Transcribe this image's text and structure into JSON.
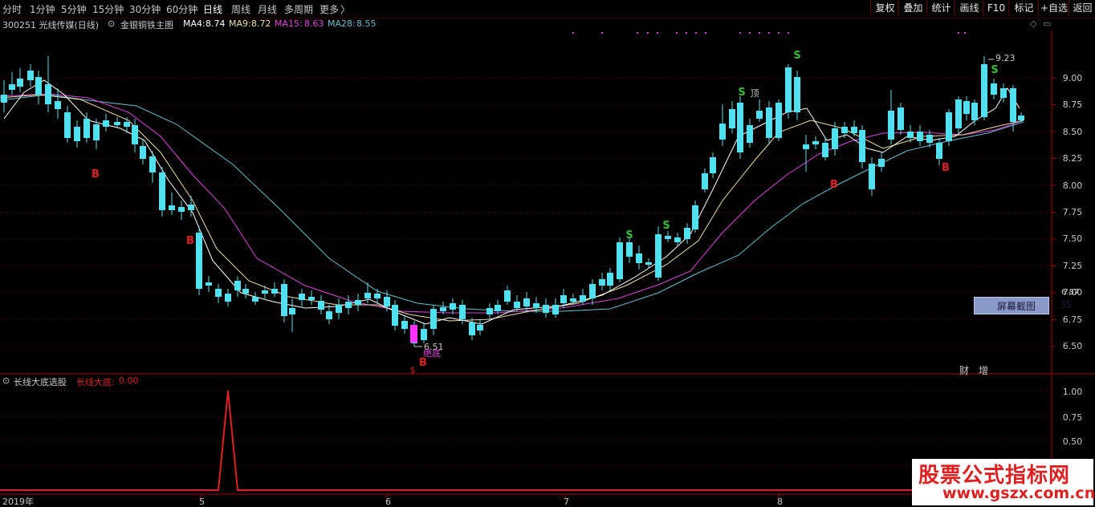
{
  "topbar": {
    "periods": [
      "分时",
      "1分钟",
      "5分钟",
      "15分钟",
      "30分钟",
      "60分钟",
      "日线",
      "周线",
      "月线",
      "多周期",
      "更多"
    ],
    "active_period": "日线",
    "more_arrow": "〉",
    "right_buttons": [
      "复权",
      "叠加",
      "统计",
      "画线",
      "F10",
      "标记",
      "+自选",
      "返回"
    ]
  },
  "info": {
    "stock": "300251 光线传媒(日线)",
    "indicator": "金银铜铁主图",
    "ma4_label": "MA4:",
    "ma4_value": "8.74",
    "ma9_label": "MA9:",
    "ma9_value": "8.72",
    "ma15_label": "MA15:",
    "ma15_value": "8.63",
    "ma28_label": "MA28:",
    "ma28_value": "8.55",
    "colors": {
      "ma4": "#ffffff",
      "ma9": "#f0e0a0",
      "ma15": "#e040e0",
      "ma28": "#60c0d0"
    }
  },
  "main_chart": {
    "y_ticks": [
      "9.00",
      "8.75",
      "8.50",
      "8.25",
      "8.00",
      "7.75",
      "7.50",
      "7.25",
      "7.00",
      "6.75",
      "6.50"
    ],
    "high_label": "9.23",
    "low_label": "6.51",
    "bottom_label": "绝底",
    "annot": "顶",
    "marks": {
      "buy": "B",
      "sell": "S"
    },
    "fin_buttons": [
      "财",
      "增"
    ]
  },
  "popup": {
    "label": "屏幕截图",
    "value": "35",
    "hidden_price": "6.87"
  },
  "indicator_panel": {
    "name": "长线大底选股",
    "line_label": "长线大底:",
    "line_value": "0.00",
    "y_ticks": [
      "1.00",
      "0.75",
      "0.50"
    ]
  },
  "x_axis": {
    "labels": [
      "2019年",
      "5",
      "6",
      "7",
      "8"
    ]
  },
  "watermark": {
    "line1": "股票公式指标网",
    "line2": "www.gszx.com.cn"
  }
}
